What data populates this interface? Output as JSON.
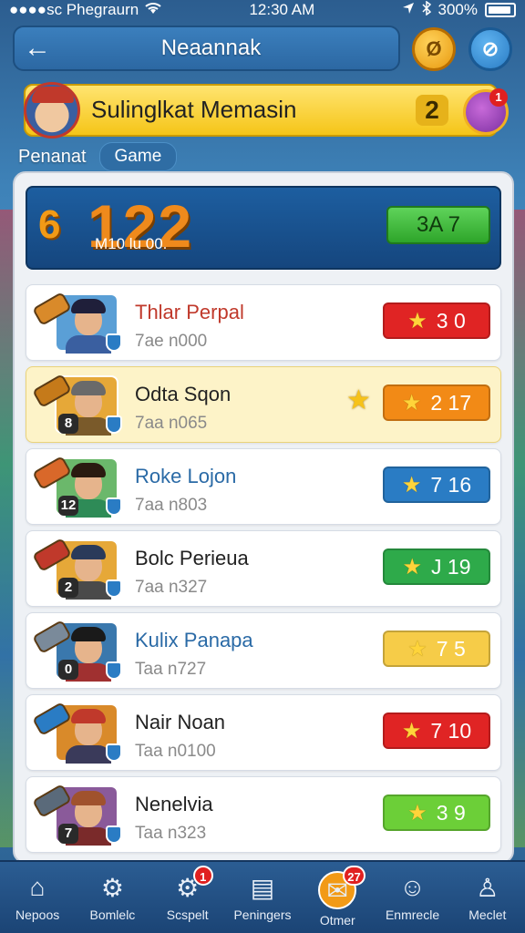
{
  "status_bar": {
    "carrier": "●●●●sc Phegraurn",
    "wifi_icon": "wifi-icon",
    "time": "12:30 AM",
    "location_icon": "location-arrow-icon",
    "bluetooth_icon": "bluetooth-icon",
    "battery": "300%"
  },
  "header": {
    "back_icon": "←",
    "title": "Neaannak",
    "coin_icon": "Ø",
    "edit_icon": "⊘"
  },
  "player": {
    "name": "Sulinglkat Memasin",
    "level": "2",
    "gift_badge": "1"
  },
  "tabs": [
    {
      "label": "Penanat"
    },
    {
      "label": "Game"
    }
  ],
  "score_card": {
    "icon": "6",
    "value": "122",
    "subtitle": "M10 lu 00.",
    "button": "3A 7"
  },
  "leaderboard": [
    {
      "name": "Thlar Perpal",
      "sub": "7ae n000",
      "badge": "3 0",
      "level": "",
      "btn_color": "#e02424",
      "side_star": false,
      "highlight": false,
      "thumb_bg": "#5a9fd6",
      "hair": "#1f1f3a",
      "body": "#3a5fa0",
      "cannon": "#d98a2a",
      "name_color": "#c0392b"
    },
    {
      "name": "Odta Sqon",
      "sub": "7aa n065",
      "badge": "2 17",
      "level": "8",
      "btn_color": "#f28a16",
      "side_star": true,
      "highlight": true,
      "thumb_bg": "#e6a838",
      "hair": "#6a6a6a",
      "body": "#7a5a2a",
      "cannon": "#c57a1a",
      "name_color": "#222222"
    },
    {
      "name": "Roke Lojon",
      "sub": "7aa n803",
      "badge": "7 16",
      "level": "12",
      "btn_color": "#2a7cc4",
      "side_star": false,
      "highlight": false,
      "thumb_bg": "#6bb86b",
      "hair": "#2a1a10",
      "body": "#2e8b57",
      "cannon": "#d9682a",
      "name_color": "#2a6aa6"
    },
    {
      "name": "Bolc Perieua",
      "sub": "7aa n327",
      "badge": "J 19",
      "level": "2",
      "btn_color": "#2eaa4a",
      "side_star": false,
      "highlight": false,
      "thumb_bg": "#e6a838",
      "hair": "#2a3a5a",
      "body": "#4a4a4a",
      "cannon": "#c0392b",
      "name_color": "#222222"
    },
    {
      "name": "Kulix Panapa",
      "sub": "Taa n727",
      "badge": "7 5",
      "level": "0",
      "btn_color": "#f6cc48",
      "side_star": false,
      "highlight": false,
      "thumb_bg": "#3a78ad",
      "hair": "#1a1a1a",
      "body": "#a03030",
      "cannon": "#7a8a9a",
      "name_color": "#2a6aa6"
    },
    {
      "name": "Nair Noan",
      "sub": "Taa n0100",
      "badge": "7 10",
      "level": "",
      "btn_color": "#e02424",
      "side_star": false,
      "highlight": false,
      "thumb_bg": "#d98a2a",
      "hair": "#c0392b",
      "body": "#3a3a5a",
      "cannon": "#2a7cc4",
      "name_color": "#222222"
    },
    {
      "name": "Nenelvia",
      "sub": "Taa n323",
      "badge": "3 9",
      "level": "7",
      "btn_color": "#6ccf38",
      "side_star": false,
      "highlight": false,
      "thumb_bg": "#8a5a9a",
      "hair": "#a0522d",
      "body": "#7a2a2a",
      "cannon": "#5a6a7a",
      "name_color": "#222222"
    }
  ],
  "bottom_nav": [
    {
      "label": "Nepoos",
      "icon": "⌂",
      "badge": ""
    },
    {
      "label": "Bomlelc",
      "icon": "⚙",
      "badge": ""
    },
    {
      "label": "Scspelt",
      "icon": "⚙",
      "badge": "1"
    },
    {
      "label": "Peningers",
      "icon": "▤",
      "badge": ""
    },
    {
      "label": "Otmer",
      "icon": "✉",
      "badge": "27"
    },
    {
      "label": "Enmrecle",
      "icon": "☺",
      "badge": ""
    },
    {
      "label": "Meclet",
      "icon": "♙",
      "badge": ""
    }
  ]
}
